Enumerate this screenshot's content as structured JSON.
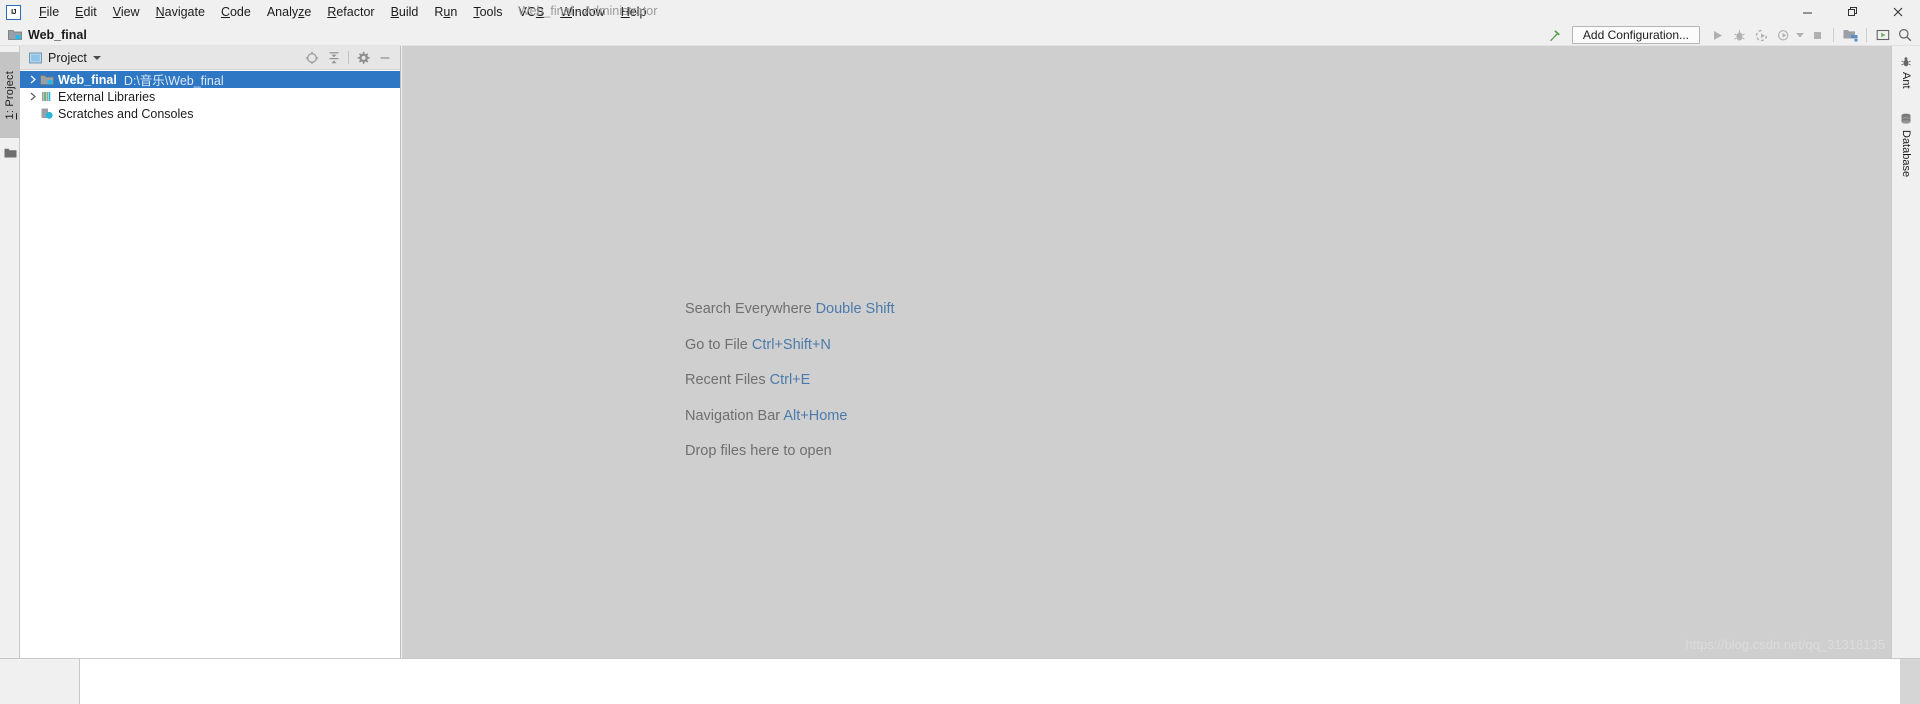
{
  "window": {
    "title": "Web_final - Administrator",
    "logo_text": "IJ",
    "controls": {
      "minimize": "minimize-icon",
      "maximize": "restore-icon",
      "close": "close-icon"
    }
  },
  "menubar": {
    "items": [
      {
        "label": "File",
        "mnemonic": "F"
      },
      {
        "label": "Edit",
        "mnemonic": "E"
      },
      {
        "label": "View",
        "mnemonic": "V"
      },
      {
        "label": "Navigate",
        "mnemonic": "N"
      },
      {
        "label": "Code",
        "mnemonic": "C"
      },
      {
        "label": "Analyze",
        "mnemonic": "z"
      },
      {
        "label": "Refactor",
        "mnemonic": "R"
      },
      {
        "label": "Build",
        "mnemonic": "B"
      },
      {
        "label": "Run",
        "mnemonic": "u"
      },
      {
        "label": "Tools",
        "mnemonic": "T"
      },
      {
        "label": "VCS",
        "mnemonic": "S"
      },
      {
        "label": "Window",
        "mnemonic": "W"
      },
      {
        "label": "Help",
        "mnemonic": "H"
      }
    ]
  },
  "navbar": {
    "breadcrumb": "Web_final"
  },
  "runbar": {
    "build_icon": "hammer-icon",
    "add_configuration_label": "Add Configuration...",
    "buttons": [
      {
        "name": "run-icon",
        "glyph": "run"
      },
      {
        "name": "debug-icon",
        "glyph": "debug"
      },
      {
        "name": "run-coverage-icon",
        "glyph": "coverage"
      },
      {
        "name": "profile-icon",
        "glyph": "profile"
      },
      {
        "name": "stop-icon",
        "glyph": "stop"
      }
    ],
    "right_buttons": [
      {
        "name": "project-structure-icon",
        "glyph": "structure"
      },
      {
        "name": "updates-icon",
        "glyph": "updates"
      },
      {
        "name": "search-icon",
        "glyph": "search"
      }
    ]
  },
  "left_tool_window": {
    "tab_index": "1",
    "tab_label": ": Project",
    "tab_full": "1: Project",
    "structure_icon": "folder-icon"
  },
  "project_panel": {
    "title": "Project",
    "title_icon": "project-module-icon",
    "dropdown_icon": "chevron-down-icon",
    "toolbar_icons": [
      {
        "name": "locate-file-icon",
        "glyph": "crosshair"
      },
      {
        "name": "collapse-all-icon",
        "glyph": "collapse"
      },
      {
        "name": "settings-icon",
        "glyph": "gear"
      },
      {
        "name": "hide-icon",
        "glyph": "minus"
      }
    ],
    "tree": [
      {
        "label": "Web_final",
        "path": "D:\\音乐\\Web_final",
        "icon": "module-folder-icon",
        "expandable": true,
        "selected": true,
        "depth": 0
      },
      {
        "label": "External Libraries",
        "path": "",
        "icon": "libraries-icon",
        "expandable": true,
        "selected": false,
        "depth": 0
      },
      {
        "label": "Scratches and Consoles",
        "path": "",
        "icon": "scratches-icon",
        "expandable": false,
        "selected": false,
        "depth": 0
      }
    ]
  },
  "editor": {
    "hints": [
      {
        "action": "Search Everywhere",
        "shortcut": "Double Shift"
      },
      {
        "action": "Go to File",
        "shortcut": "Ctrl+Shift+N"
      },
      {
        "action": "Recent Files",
        "shortcut": "Ctrl+E"
      },
      {
        "action": "Navigation Bar",
        "shortcut": "Alt+Home"
      },
      {
        "action": "Drop files here to open",
        "shortcut": ""
      }
    ],
    "watermark": "https://blog.csdn.net/qq_31318135"
  },
  "right_tool_window": {
    "tabs": [
      {
        "label": "Ant",
        "icon": "ant-icon"
      },
      {
        "label": "Database",
        "icon": "database-icon"
      }
    ]
  },
  "colors": {
    "selection_blue": "#2e77c4",
    "shortcut_blue": "#4c7bab",
    "editor_bg": "#cfcfcf",
    "chrome_bg": "#f0f0f0",
    "panel_bg": "#ffffff"
  }
}
